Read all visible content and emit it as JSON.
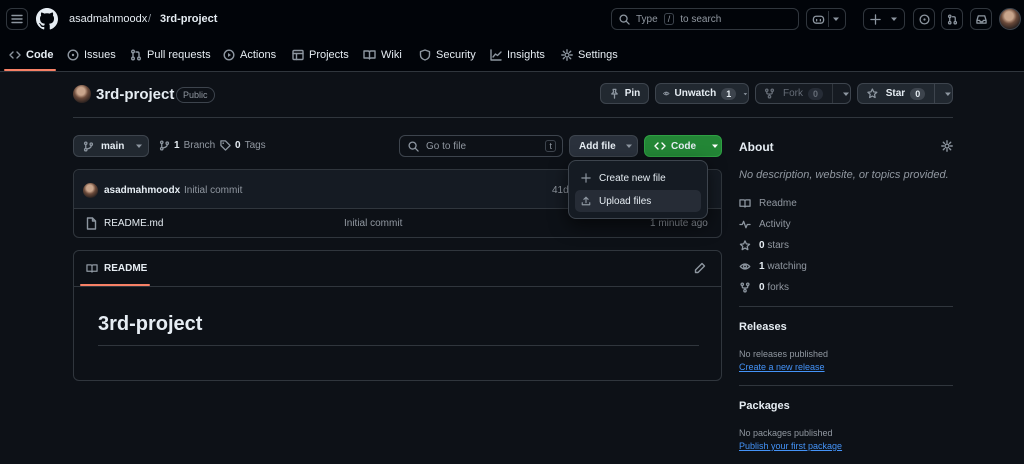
{
  "header": {
    "owner": "asadmahmoodx",
    "separator": "/",
    "repo": "3rd-project",
    "search_prefix": "Type",
    "search_key": "/",
    "search_suffix": "to search"
  },
  "tabs": [
    {
      "label": "Code",
      "icon": "code-icon"
    },
    {
      "label": "Issues",
      "icon": "issue-icon"
    },
    {
      "label": "Pull requests",
      "icon": "pull-request-icon"
    },
    {
      "label": "Actions",
      "icon": "play-icon"
    },
    {
      "label": "Projects",
      "icon": "table-icon"
    },
    {
      "label": "Wiki",
      "icon": "book-icon"
    },
    {
      "label": "Security",
      "icon": "shield-icon"
    },
    {
      "label": "Insights",
      "icon": "graph-icon"
    },
    {
      "label": "Settings",
      "icon": "gear-icon"
    }
  ],
  "repo_head": {
    "name": "3rd-project",
    "visibility": "Public",
    "pin": "Pin",
    "unwatch": "Unwatch",
    "watch_count": "1",
    "fork": "Fork",
    "fork_count": "0",
    "star": "Star",
    "star_count": "0"
  },
  "toolbar": {
    "branch": "main",
    "branches_count": "1",
    "branches_label": "Branch",
    "tags_count": "0",
    "tags_label": "Tags",
    "go_to_file_placeholder": "Go to file",
    "go_to_file_key": "t",
    "add_file": "Add file",
    "code": "Code"
  },
  "add_file_menu": {
    "create": "Create new file",
    "upload": "Upload files"
  },
  "commit": {
    "author": "asadmahmoodx",
    "message": "Initial commit",
    "hash_fragment": "41d"
  },
  "files": [
    {
      "name": "README.md",
      "message": "Initial commit",
      "time": "1 minute ago"
    }
  ],
  "readme": {
    "tab": "README",
    "heading": "3rd-project"
  },
  "about": {
    "title": "About",
    "description": "No description, website, or topics provided.",
    "readme": "Readme",
    "activity": "Activity",
    "stars_count": "0",
    "stars_label": "stars",
    "watching_count": "1",
    "watching_label": "watching",
    "forks_count": "0",
    "forks_label": "forks"
  },
  "releases": {
    "title": "Releases",
    "empty": "No releases published",
    "create_link": "Create a new release"
  },
  "packages": {
    "title": "Packages",
    "empty": "No packages published",
    "publish_link": "Publish your first package"
  },
  "colors": {
    "accent_green": "#238636",
    "tab_underline": "#f78166",
    "link": "#4493f8",
    "background": "#0d1117"
  }
}
